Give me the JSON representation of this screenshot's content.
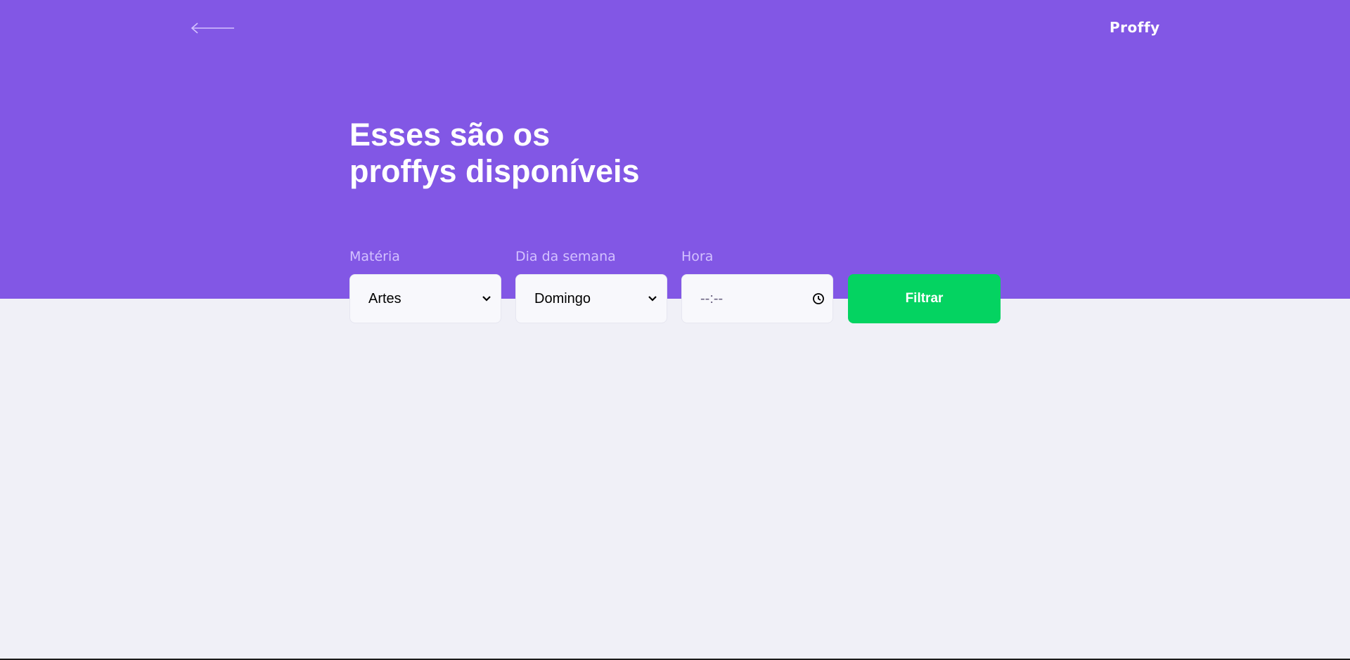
{
  "header": {
    "back_icon": "arrow-left-icon",
    "logo_text": "Proffy",
    "title_line1": "Esses são os",
    "title_line2": "proffys disponíveis",
    "background_color": "#8257E5"
  },
  "filters": {
    "subject": {
      "label": "Matéria",
      "value": "Artes",
      "icon": "chevron-down-icon"
    },
    "week_day": {
      "label": "Dia da semana",
      "value": "Domingo",
      "icon": "chevron-down-icon"
    },
    "time": {
      "label": "Hora",
      "placeholder": "--:--",
      "icon": "clock-icon"
    },
    "submit_label": "Filtrar",
    "submit_color": "#04D361"
  },
  "colors": {
    "page_background": "#F0F0F7",
    "label_color": "#D4C2FF",
    "input_background": "#F8F8FC"
  }
}
